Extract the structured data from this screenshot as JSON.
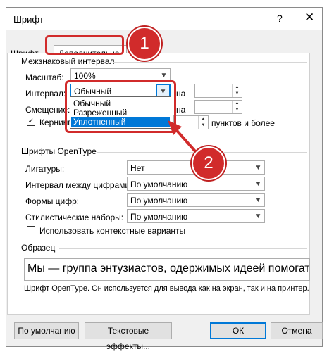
{
  "window": {
    "title": "Шрифт",
    "help_glyph": "?",
    "close_glyph": "✕"
  },
  "tabs": [
    {
      "label": "Шрифт"
    },
    {
      "label": "Дополнительно"
    }
  ],
  "spacing": {
    "group_title": "Межзнаковый интервал",
    "scale_label": "Масштаб:",
    "scale_value": "100%",
    "interval_label": "Интервал:",
    "interval_value": "Обычный",
    "offset_label": "Смещение:",
    "on_label": "на",
    "on_label2": "на",
    "kerning_label": "Кернинг",
    "kerning_suffix": "пунктов и более",
    "dropdown_options": [
      "Обычный",
      "Разреженный",
      "Уплотненный"
    ],
    "dropdown_selected": "Уплотненный"
  },
  "opentype": {
    "group_title": "Шрифты OpenType",
    "ligatures_label": "Лигатуры:",
    "ligatures_value": "Нет",
    "numspacing_label": "Интервал между цифрами:",
    "numspacing_value": "По умолчанию",
    "numforms_label": "Формы цифр:",
    "numforms_value": "По умолчанию",
    "stylistic_label": "Стилистические наборы:",
    "stylistic_value": "По умолчанию",
    "contextual_label": "Использовать контекстные варианты"
  },
  "sample": {
    "group_title": "Образец",
    "text": "Мы — группа энтузиастов, одержимых идеей помогать В",
    "note": "Шрифт OpenType. Он используется для вывода как на экран, так и на принтер."
  },
  "buttons": {
    "default_label": "По умолчанию",
    "effects_label": "Текстовые эффекты...",
    "ok_label": "ОК",
    "cancel_label": "Отмена"
  },
  "annotations": {
    "badge1": "1",
    "badge2": "2",
    "highlight_color": "#d12b2b"
  }
}
